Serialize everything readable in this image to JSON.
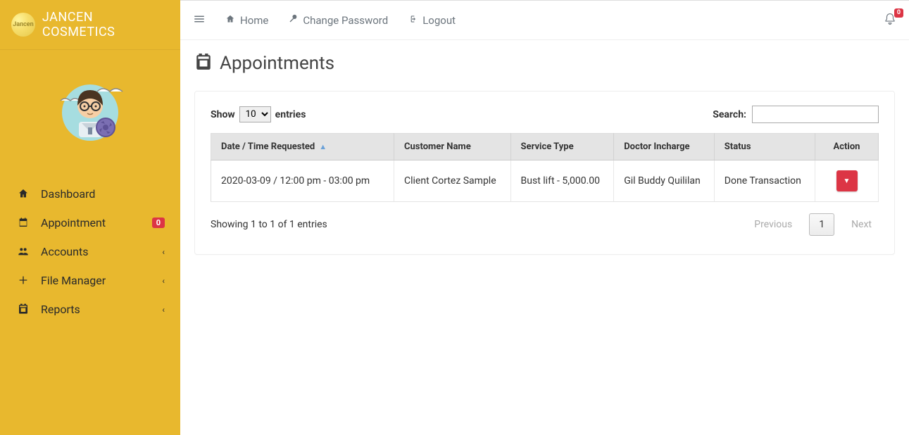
{
  "brand": {
    "title": "JANCEN COSMETICS",
    "logo_text": "Jancen"
  },
  "sidebar": {
    "items": [
      {
        "label": "Dashboard"
      },
      {
        "label": "Appointment",
        "badge": "0"
      },
      {
        "label": "Accounts"
      },
      {
        "label": "File Manager"
      },
      {
        "label": "Reports"
      }
    ]
  },
  "topbar": {
    "home": "Home",
    "change_password": "Change Password",
    "logout": "Logout",
    "bell_badge": "0"
  },
  "page": {
    "title": "Appointments"
  },
  "table": {
    "show_label_pre": "Show",
    "show_label_post": "entries",
    "show_value": "10",
    "search_label": "Search:",
    "search_value": "",
    "headers": {
      "date": "Date / Time Requested",
      "customer": "Customer Name",
      "service": "Service Type",
      "doctor": "Doctor Incharge",
      "status": "Status",
      "action": "Action"
    },
    "rows": [
      {
        "date": "2020-03-09 / 12:00 pm - 03:00 pm",
        "customer": "Client Cortez Sample",
        "service": "Bust lift - 5,000.00",
        "doctor": "Gil Buddy Quililan",
        "status": "Done Transaction"
      }
    ],
    "info": "Showing 1 to 1 of 1 entries",
    "prev": "Previous",
    "page_current": "1",
    "next": "Next"
  }
}
